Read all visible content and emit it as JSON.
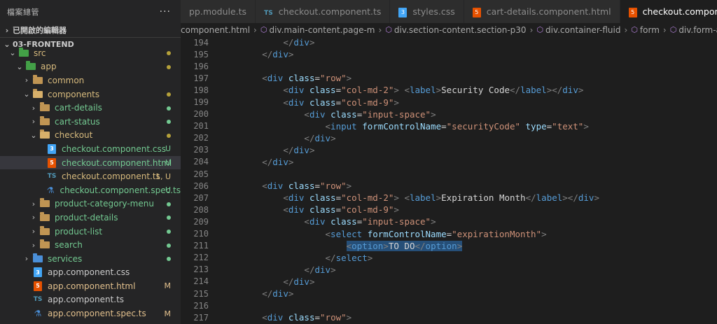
{
  "sidebar": {
    "header_title": "檔案總管",
    "more_label": "···",
    "open_editors_label": "已開啟的編輯器",
    "project_label": "03-FRONTEND",
    "tree": [
      {
        "label": "src",
        "type": "folder-green",
        "level": 1,
        "open": true,
        "status": "",
        "dot": "#b5a13a",
        "color": "#d7ba7d"
      },
      {
        "label": "app",
        "type": "folder-green",
        "level": 2,
        "open": true,
        "status": "",
        "dot": "#b5a13a",
        "color": "#d7ba7d"
      },
      {
        "label": "common",
        "type": "folder",
        "level": 3,
        "open": false,
        "status": "",
        "dot": "",
        "color": "#d7ba7d"
      },
      {
        "label": "components",
        "type": "folder-open",
        "level": 3,
        "open": true,
        "status": "",
        "dot": "#b5a13a",
        "color": "#d7ba7d"
      },
      {
        "label": "cart-details",
        "type": "folder",
        "level": 4,
        "open": false,
        "status": "",
        "dot": "#73c991",
        "color": "#73c991"
      },
      {
        "label": "cart-status",
        "type": "folder",
        "level": 4,
        "open": false,
        "status": "",
        "dot": "#73c991",
        "color": "#73c991"
      },
      {
        "label": "checkout",
        "type": "folder-open",
        "level": 4,
        "open": true,
        "status": "",
        "dot": "#b5a13a",
        "color": "#d7ba7d"
      },
      {
        "label": "checkout.component.css",
        "type": "css",
        "level": 5,
        "status": "U",
        "dot": "",
        "color": "#73c991"
      },
      {
        "label": "checkout.component.html",
        "type": "html",
        "level": 5,
        "status": "U",
        "dot": "",
        "color": "#73c991",
        "selected": true
      },
      {
        "label": "checkout.component.ts",
        "type": "ts",
        "level": 5,
        "status": "1, U",
        "dot": "",
        "color": "#d7ba7d"
      },
      {
        "label": "checkout.component.spec.ts",
        "type": "spec",
        "level": 5,
        "status": "U",
        "dot": "",
        "color": "#73c991"
      },
      {
        "label": "product-category-menu",
        "type": "folder",
        "level": 4,
        "open": false,
        "status": "",
        "dot": "#73c991",
        "color": "#73c991"
      },
      {
        "label": "product-details",
        "type": "folder",
        "level": 4,
        "open": false,
        "status": "",
        "dot": "#73c991",
        "color": "#73c991"
      },
      {
        "label": "product-list",
        "type": "folder",
        "level": 4,
        "open": false,
        "status": "",
        "dot": "#73c991",
        "color": "#73c991"
      },
      {
        "label": "search",
        "type": "folder",
        "level": 4,
        "open": false,
        "status": "",
        "dot": "#73c991",
        "color": "#73c991"
      },
      {
        "label": "services",
        "type": "folder-blue",
        "level": 3,
        "open": false,
        "status": "",
        "dot": "#73c991",
        "color": "#73c991"
      },
      {
        "label": "app.component.css",
        "type": "css",
        "level": 3,
        "status": "",
        "dot": "",
        "color": "#cccccc"
      },
      {
        "label": "app.component.html",
        "type": "html",
        "level": 3,
        "status": "M",
        "dot": "",
        "color": "#e2c08d"
      },
      {
        "label": "app.component.ts",
        "type": "ts",
        "level": 3,
        "status": "",
        "dot": "",
        "color": "#cccccc"
      },
      {
        "label": "app.component.spec.ts",
        "type": "spec",
        "level": 3,
        "status": "M",
        "dot": "",
        "color": "#e2c08d"
      }
    ]
  },
  "tabs": [
    {
      "label": "pp.module.ts",
      "icon": "ts",
      "active": false
    },
    {
      "label": "checkout.component.ts",
      "icon": "ts",
      "active": false
    },
    {
      "label": "styles.css",
      "icon": "css",
      "active": false
    },
    {
      "label": "cart-details.component.html",
      "icon": "html",
      "active": false
    },
    {
      "label": "checkout.component.html",
      "icon": "html",
      "active": true,
      "close": "×"
    }
  ],
  "breadcrumb": [
    "component.html",
    "div.main-content.page-m",
    "div.section-content.section-p30",
    "div.container-fluid",
    "form",
    "div.form-are"
  ],
  "code": [
    {
      "n": "194",
      "html": "            <span class='br'>&lt;/</span><span class='tg'>div</span><span class='br'>&gt;</span>"
    },
    {
      "n": "195",
      "html": "        <span class='br'>&lt;/</span><span class='tg'>div</span><span class='br'>&gt;</span>"
    },
    {
      "n": "196",
      "html": ""
    },
    {
      "n": "197",
      "html": "        <span class='br'>&lt;</span><span class='tg'>div</span> <span class='at'>class</span><span class='tx'>=</span><span class='st'>\"row\"</span><span class='br'>&gt;</span>"
    },
    {
      "n": "198",
      "html": "            <span class='br'>&lt;</span><span class='tg'>div</span> <span class='at'>class</span><span class='tx'>=</span><span class='st'>\"col-md-2\"</span><span class='br'>&gt;</span> <span class='br'>&lt;</span><span class='tg'>label</span><span class='br'>&gt;</span><span class='tx'>Security Code</span><span class='br'>&lt;/</span><span class='tg'>label</span><span class='br'>&gt;&lt;/</span><span class='tg'>div</span><span class='br'>&gt;</span>"
    },
    {
      "n": "199",
      "html": "            <span class='br'>&lt;</span><span class='tg'>div</span> <span class='at'>class</span><span class='tx'>=</span><span class='st'>\"col-md-9\"</span><span class='br'>&gt;</span>"
    },
    {
      "n": "200",
      "html": "                <span class='br'>&lt;</span><span class='tg'>div</span> <span class='at'>class</span><span class='tx'>=</span><span class='st'>\"input-space\"</span><span class='br'>&gt;</span>"
    },
    {
      "n": "201",
      "html": "                    <span class='br'>&lt;</span><span class='tg'>input</span> <span class='at'>formControlName</span><span class='tx'>=</span><span class='st'>\"securityCode\"</span> <span class='at'>type</span><span class='tx'>=</span><span class='st'>\"text\"</span><span class='br'>&gt;</span>"
    },
    {
      "n": "202",
      "html": "                <span class='br'>&lt;/</span><span class='tg'>div</span><span class='br'>&gt;</span>"
    },
    {
      "n": "203",
      "html": "            <span class='br'>&lt;/</span><span class='tg'>div</span><span class='br'>&gt;</span>"
    },
    {
      "n": "204",
      "html": "        <span class='br'>&lt;/</span><span class='tg'>div</span><span class='br'>&gt;</span>"
    },
    {
      "n": "205",
      "html": ""
    },
    {
      "n": "206",
      "html": "        <span class='br'>&lt;</span><span class='tg'>div</span> <span class='at'>class</span><span class='tx'>=</span><span class='st'>\"row\"</span><span class='br'>&gt;</span>"
    },
    {
      "n": "207",
      "html": "            <span class='br'>&lt;</span><span class='tg'>div</span> <span class='at'>class</span><span class='tx'>=</span><span class='st'>\"col-md-2\"</span><span class='br'>&gt;</span> <span class='br'>&lt;</span><span class='tg'>label</span><span class='br'>&gt;</span><span class='tx'>Expiration Month</span><span class='br'>&lt;/</span><span class='tg'>label</span><span class='br'>&gt;&lt;/</span><span class='tg'>div</span><span class='br'>&gt;</span>"
    },
    {
      "n": "208",
      "html": "            <span class='br'>&lt;</span><span class='tg'>div</span> <span class='at'>class</span><span class='tx'>=</span><span class='st'>\"col-md-9\"</span><span class='br'>&gt;</span>"
    },
    {
      "n": "209",
      "html": "                <span class='br'>&lt;</span><span class='tg'>div</span> <span class='at'>class</span><span class='tx'>=</span><span class='st'>\"input-space\"</span><span class='br'>&gt;</span>"
    },
    {
      "n": "210",
      "html": "                    <span class='br'>&lt;</span><span class='tg'>select</span> <span class='at'>formControlName</span><span class='tx'>=</span><span class='st'>\"expirationMonth\"</span><span class='br'>&gt;</span>"
    },
    {
      "n": "211",
      "html": "                        <span class='hl'><span class='br'>&lt;</span><span class='tg'>option</span><span class='br'>&gt;</span><span class='tx'>TO DO</span><span class='br'>&lt;/</span><span class='tg'>option</span><span class='br'>&gt;</span></span>"
    },
    {
      "n": "212",
      "html": "                    <span class='br'>&lt;/</span><span class='tg'>select</span><span class='br'>&gt;</span>"
    },
    {
      "n": "213",
      "html": "                <span class='br'>&lt;/</span><span class='tg'>div</span><span class='br'>&gt;</span>"
    },
    {
      "n": "214",
      "html": "            <span class='br'>&lt;/</span><span class='tg'>div</span><span class='br'>&gt;</span>"
    },
    {
      "n": "215",
      "html": "        <span class='br'>&lt;/</span><span class='tg'>div</span><span class='br'>&gt;</span>"
    },
    {
      "n": "216",
      "html": ""
    },
    {
      "n": "217",
      "html": "        <span class='br'>&lt;</span><span class='tg'>div</span> <span class='at'>class</span><span class='tx'>=</span><span class='st'>\"row\"</span><span class='br'>&gt;</span>"
    }
  ]
}
